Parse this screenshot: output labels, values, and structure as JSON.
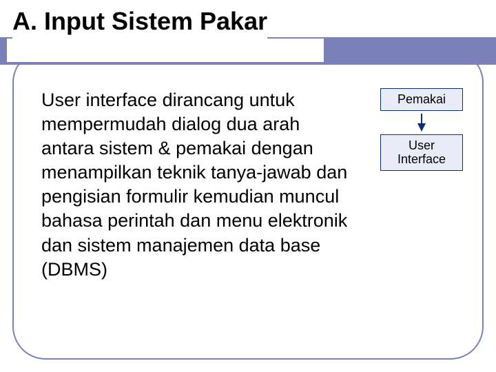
{
  "title": "A. Input Sistem Pakar",
  "body": "User interface dirancang untuk mempermudah dialog dua arah antara sistem & pemakai dengan menampilkan teknik tanya-jawab dan pengisian formulir kemudian muncul bahasa perintah dan menu elektronik dan sistem manajemen data base (DBMS)",
  "diagram": {
    "box1": "Pemakai",
    "box2_line1": "User",
    "box2_line2": "Interface"
  },
  "colors": {
    "accent": "#7a81b9",
    "box_border": "#0a2a7a",
    "box_fill": "#e9ecf7"
  }
}
